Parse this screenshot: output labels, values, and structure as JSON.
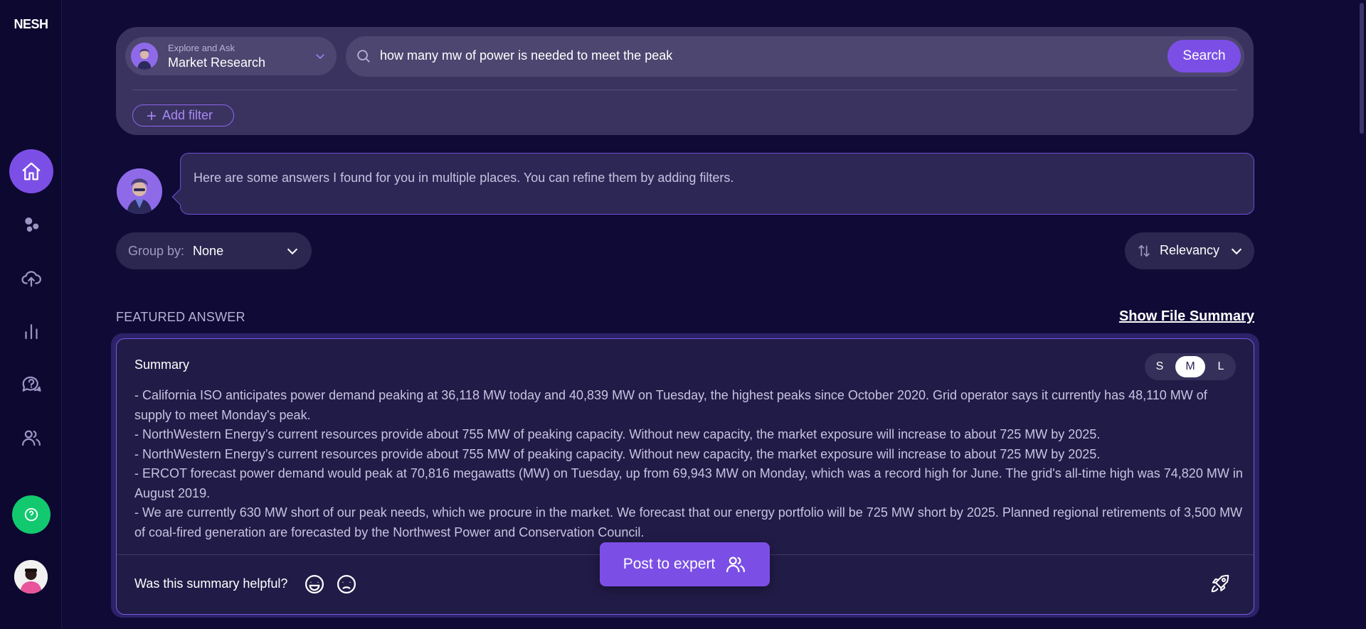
{
  "app": {
    "logo": "NESH"
  },
  "sidebar": {
    "items": [
      {
        "name": "home",
        "icon": "home-icon",
        "active": true
      },
      {
        "name": "bubbles",
        "icon": "bubbles-icon"
      },
      {
        "name": "upload",
        "icon": "cloud-upload-icon"
      },
      {
        "name": "analytics",
        "icon": "bar-chart-icon"
      },
      {
        "name": "questions",
        "icon": "chat-question-icon"
      },
      {
        "name": "users",
        "icon": "users-icon"
      }
    ],
    "help_icon": "question-icon"
  },
  "search": {
    "source_caption": "Explore and Ask",
    "source_value": "Market Research",
    "query": "how many mw of power is needed to meet the peak",
    "button_label": "Search",
    "add_filter_label": "Add filter"
  },
  "bot": {
    "message": "Here are some answers I found for you in multiple places. You can refine them by adding filters."
  },
  "controls": {
    "group_by_label": "Group by:",
    "group_by_value": "None",
    "sort_value": "Relevancy"
  },
  "featured": {
    "section_label": "FEATURED ANSWER",
    "file_summary_link": "Show File Summary",
    "card_title": "Summary",
    "sizes": [
      "S",
      "M",
      "L"
    ],
    "active_size": "M",
    "lines": [
      "- California ISO anticipates power demand peaking at 36,118 MW today and 40,839 MW on Tuesday, the highest peaks since October 2020. Grid operator says it currently has 48,110 MW of supply to meet Monday's peak.",
      "- NorthWestern Energy’s current resources provide about 755 MW of peaking capacity. Without new capacity, the market exposure will increase to about 725 MW by 2025.",
      "- NorthWestern Energy’s current resources provide about 755 MW of peaking capacity. Without new capacity, the market exposure will increase to about 725 MW by 2025.",
      "- ERCOT forecast power demand would peak at 70,816 megawatts (MW) on Tuesday, up from 69,943 MW on Monday, which was a record high for June. The grid's all-time high was 74,820 MW in August 2019.",
      "- We are currently 630 MW short of our peak needs, which we procure in the market. We forecast that our energy portfolio will be 725 MW short by 2025. Planned regional retirements of 3,500 MW of coal-fired generation are forecasted by the Northwest Power and Conservation Council."
    ],
    "helpful_prompt": "Was this summary helpful?",
    "post_expert_label": "Post to expert"
  },
  "colors": {
    "background": "#100a36",
    "accent": "#7b4fe6",
    "help_green": "#12c96f"
  }
}
